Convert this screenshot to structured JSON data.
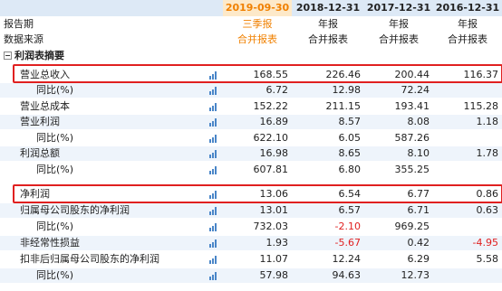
{
  "header": {
    "dates": [
      "2019-09-30",
      "2018-12-31",
      "2017-12-31",
      "2016-12-31"
    ],
    "report_period_label": "报告期",
    "report_types": [
      "三季报",
      "年报",
      "年报",
      "年报"
    ],
    "data_source_label": "数据来源",
    "data_sources": [
      "合并报表",
      "合并报表",
      "合并报表",
      "合并报表"
    ],
    "section_label": "利润表摘要"
  },
  "rows": [
    {
      "label": "营业总收入",
      "values": [
        "168.55",
        "226.46",
        "200.44",
        "116.37"
      ]
    },
    {
      "label": "同比(%)",
      "values": [
        "6.72",
        "12.98",
        "72.24",
        ""
      ]
    },
    {
      "label": "营业总成本",
      "values": [
        "152.22",
        "211.15",
        "193.41",
        "115.28"
      ]
    },
    {
      "label": "营业利润",
      "values": [
        "16.89",
        "8.57",
        "8.08",
        "1.18"
      ]
    },
    {
      "label": "同比(%)",
      "values": [
        "622.10",
        "6.05",
        "587.26",
        ""
      ]
    },
    {
      "label": "利润总额",
      "values": [
        "16.98",
        "8.65",
        "8.10",
        "1.78"
      ]
    },
    {
      "label": "同比(%)",
      "values": [
        "607.81",
        "6.80",
        "355.25",
        ""
      ]
    },
    {
      "label": "净利润",
      "values": [
        "13.06",
        "6.54",
        "6.77",
        "0.86"
      ]
    },
    {
      "label": "归属母公司股东的净利润",
      "values": [
        "13.01",
        "6.57",
        "6.71",
        "0.63"
      ]
    },
    {
      "label": "同比(%)",
      "values": [
        "732.03",
        "-2.10",
        "969.25",
        ""
      ]
    },
    {
      "label": "非经常性损益",
      "values": [
        "1.93",
        "-5.67",
        "0.42",
        "-4.95"
      ]
    },
    {
      "label": "扣非后归属母公司股东的净利润",
      "values": [
        "11.07",
        "12.24",
        "6.29",
        "5.58"
      ]
    },
    {
      "label": "同比(%)",
      "values": [
        "57.98",
        "94.63",
        "12.73",
        ""
      ]
    }
  ],
  "icons": {
    "row_chart": "bar-chart-icon",
    "section_toggle": "collapse-minus-icon"
  },
  "colors": {
    "accent": "#f08000",
    "negative": "#e02020",
    "header_bg": "#dde9f6",
    "highlight_box": "#e02020"
  }
}
